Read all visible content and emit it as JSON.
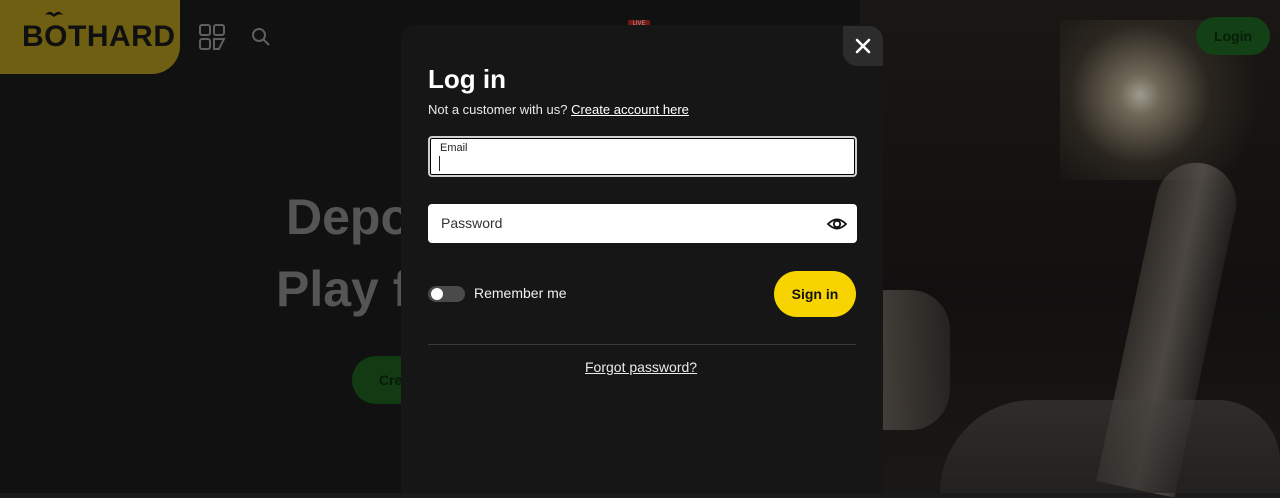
{
  "header": {
    "logo_text": "BOTHARD",
    "live_badge": "LIVE",
    "login_label": "Login"
  },
  "hero": {
    "line1": "Depo",
    "line2": "Play f",
    "cta_label": "Cre"
  },
  "modal": {
    "title": "Log in",
    "signup_prompt": "Not a customer with us?",
    "signup_link": "Create account here",
    "email_label": "Email",
    "email_value": "",
    "password_placeholder": "Password",
    "remember_label": "Remember me",
    "remember_on": false,
    "signin_label": "Sign in",
    "forgot_label": "Forgot password?"
  },
  "icons": {
    "close": "close-icon",
    "grid": "grid-icon",
    "search": "search-icon",
    "eye": "eye-icon"
  },
  "colors": {
    "brand_yellow": "#b39a1e",
    "signin_yellow": "#f7d400",
    "login_green": "#1f6a22",
    "modal_bg": "#161616"
  }
}
